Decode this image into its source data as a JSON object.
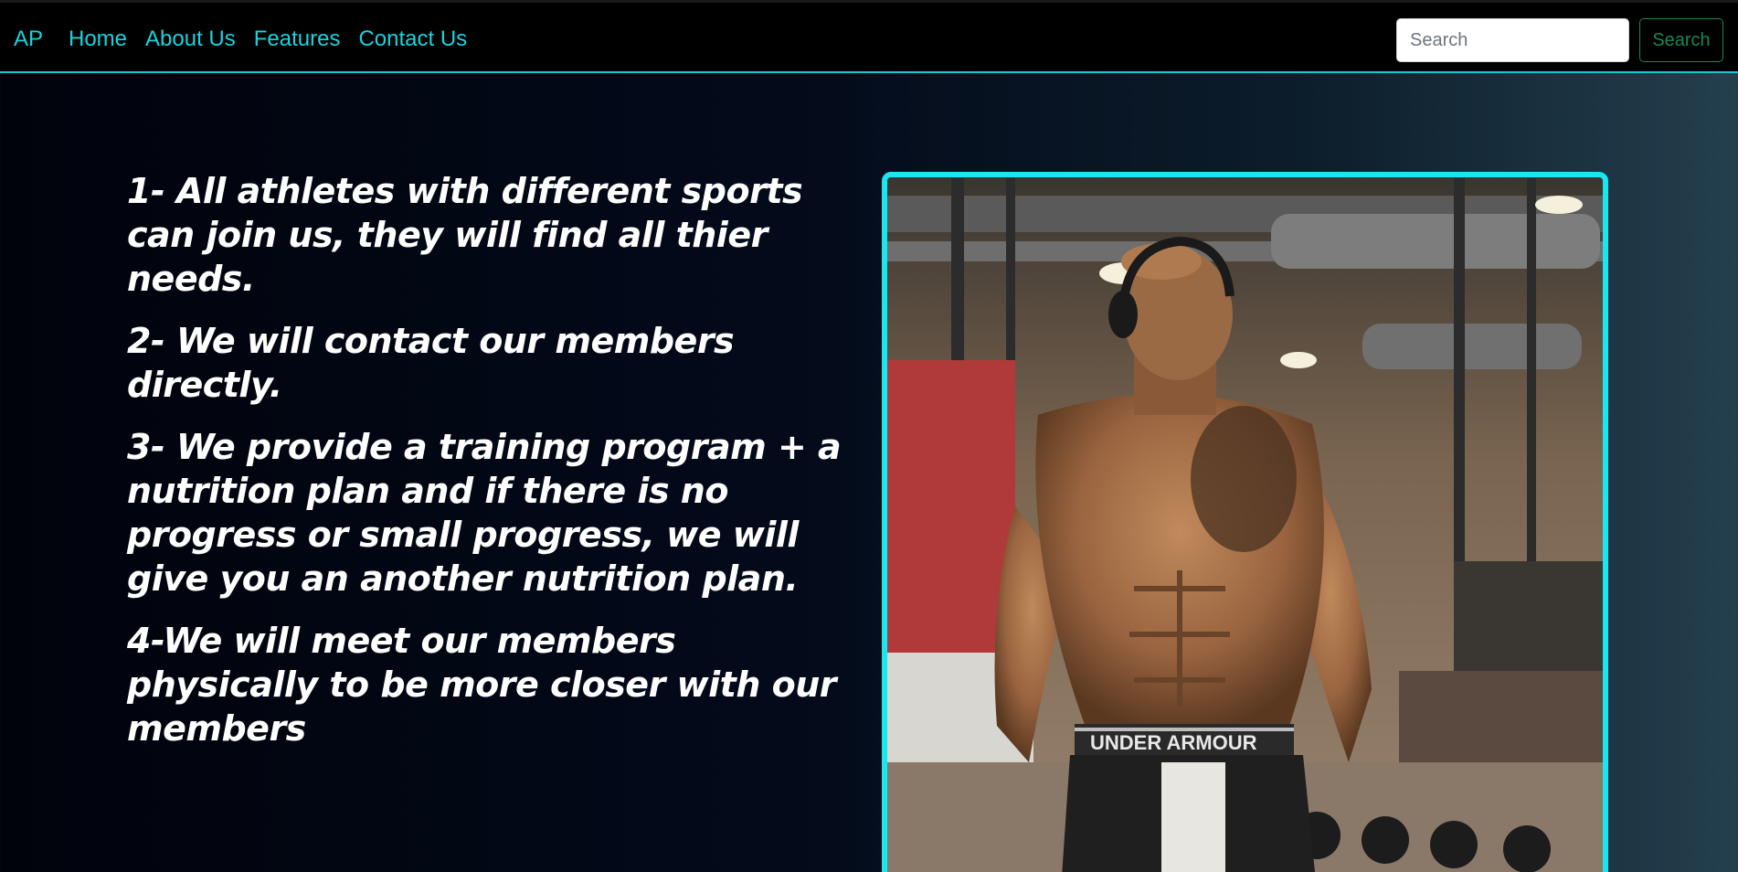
{
  "nav": {
    "brand": "AP",
    "links": [
      "Home",
      "About Us",
      "Features",
      "Contact Us"
    ]
  },
  "search": {
    "placeholder": "Search",
    "button_label": "Search"
  },
  "points": [
    "1- All athletes with different sports can join us, they will find all thier needs.",
    "2- We will contact our members directly.",
    "3- We provide a training program + a nutrition plan and if there is no progress or small progress, we will give you an another nutrition plan.",
    "4-We will meet our members physically to be more closer with our members"
  ],
  "photo": {
    "waistband_text": "UNDER ARMOUR"
  },
  "colors": {
    "accent": "#19d3dc",
    "frame_border": "#19e6ee",
    "search_button": "#198754",
    "navbar_bg": "#000000"
  }
}
